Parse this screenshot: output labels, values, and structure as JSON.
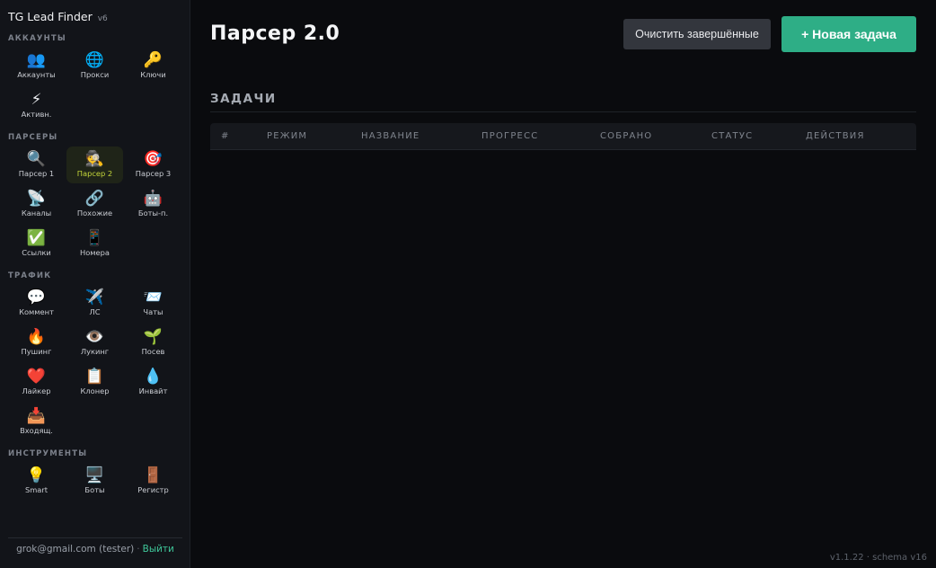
{
  "app": {
    "name": "TG Lead Finder",
    "version_badge": "v6"
  },
  "sidebar": {
    "sections": [
      {
        "title": "АККАУНТЫ",
        "items": [
          {
            "icon": "👥",
            "icon_name": "accounts-icon",
            "label": "Аккаунты"
          },
          {
            "icon": "🌐",
            "icon_name": "globe-icon",
            "label": "Прокси"
          },
          {
            "icon": "🔑",
            "icon_name": "key-icon",
            "label": "Ключи"
          },
          {
            "icon": "⚡",
            "icon_name": "lightning-icon",
            "label": "Активн."
          }
        ]
      },
      {
        "title": "ПАРСЕРЫ",
        "items": [
          {
            "icon": "🔍",
            "icon_name": "magnifier-icon",
            "label": "Парсер 1"
          },
          {
            "icon": "🕵️",
            "icon_name": "detective-icon",
            "label": "Парсер 2",
            "active": true
          },
          {
            "icon": "🎯",
            "icon_name": "target-icon",
            "label": "Парсер 3"
          },
          {
            "icon": "📡",
            "icon_name": "satellite-icon",
            "label": "Каналы"
          },
          {
            "icon": "🔗",
            "icon_name": "link-icon",
            "label": "Похожие"
          },
          {
            "icon": "🤖",
            "icon_name": "robot-icon",
            "label": "Боты-п."
          },
          {
            "icon": "✅",
            "icon_name": "check-icon",
            "label": "Ссылки"
          },
          {
            "icon": "📱",
            "icon_name": "phone-icon",
            "label": "Номера"
          }
        ]
      },
      {
        "title": "ТРАФИК",
        "items": [
          {
            "icon": "💬",
            "icon_name": "speech-bubble-icon",
            "label": "Коммент"
          },
          {
            "icon": "✈️",
            "icon_name": "airplane-icon",
            "label": "ЛС"
          },
          {
            "icon": "📨",
            "icon_name": "envelope-icon",
            "label": "Чаты"
          },
          {
            "icon": "🔥",
            "icon_name": "fire-icon",
            "label": "Пушинг"
          },
          {
            "icon": "👁️",
            "icon_name": "eye-icon",
            "label": "Лукинг"
          },
          {
            "icon": "🌱",
            "icon_name": "seedling-icon",
            "label": "Посев"
          },
          {
            "icon": "❤️",
            "icon_name": "heart-icon",
            "label": "Лайкер"
          },
          {
            "icon": "📋",
            "icon_name": "clipboard-icon",
            "label": "Клонер"
          },
          {
            "icon": "💧",
            "icon_name": "droplet-icon",
            "label": "Инвайт"
          },
          {
            "icon": "📥",
            "icon_name": "inbox-icon",
            "label": "Входящ."
          }
        ]
      },
      {
        "title": "ИНСТРУМЕНТЫ",
        "items": [
          {
            "icon": "💡",
            "icon_name": "lightbulb-icon",
            "label": "Smart"
          },
          {
            "icon": "🖥️",
            "icon_name": "monitor-icon",
            "label": "Боты"
          },
          {
            "icon": "🚪",
            "icon_name": "door-icon",
            "label": "Регистр"
          }
        ]
      }
    ],
    "footer": {
      "user": "grok@gmail.com (tester)",
      "separator": "·",
      "logout": "Выйти"
    }
  },
  "main": {
    "title": "Парсер 2.0",
    "clear_button": "Очистить завершённые",
    "new_task_button": "+ Новая задача",
    "tasks_heading": "ЗАДАЧИ",
    "table": {
      "columns": [
        "#",
        "РЕЖИМ",
        "НАЗВАНИЕ",
        "ПРОГРЕСС",
        "СОБРАНО",
        "СТАТУС",
        "ДЕЙСТВИЯ"
      ],
      "rows": []
    }
  },
  "footer": {
    "version": "v1.1.22 · schema v16"
  },
  "colors": {
    "accent": "#2eae86",
    "active_label": "#c4d63a",
    "sidebar_bg": "#121419",
    "main_bg": "#0a0b0e"
  }
}
